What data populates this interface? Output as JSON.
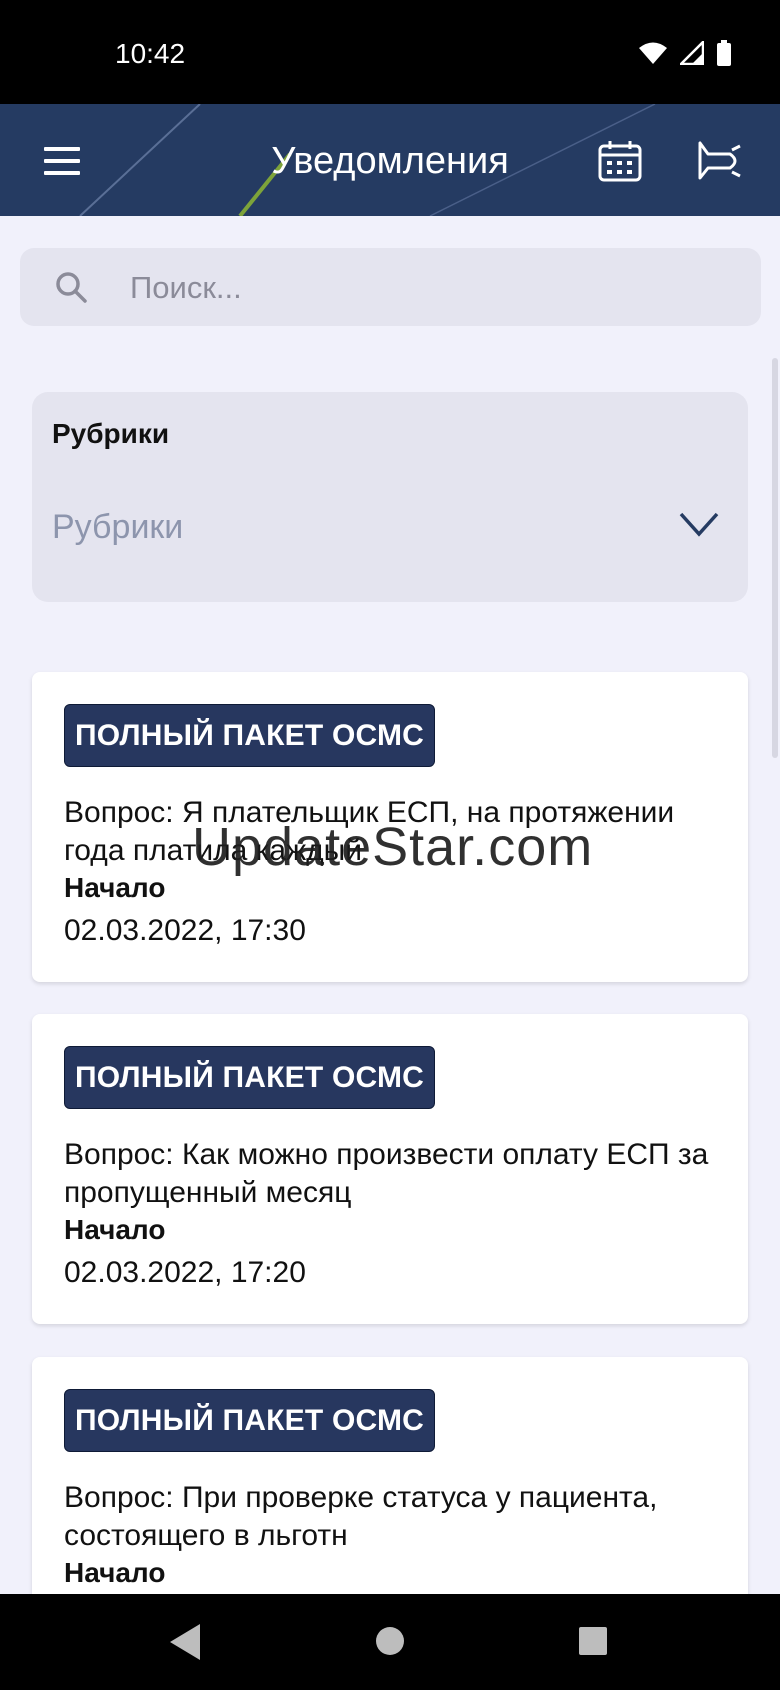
{
  "status_bar": {
    "time": "10:42"
  },
  "app_bar": {
    "title": "Уведомления"
  },
  "search": {
    "placeholder": "Поиск..."
  },
  "rubric": {
    "label": "Рубрики",
    "value": "Рубрики"
  },
  "notifications": [
    {
      "badge": "ПОЛНЫЙ ПАКЕТ ОСМС",
      "question": "Вопрос: Я плательщик ЕСП, на протяжении года платила каждый",
      "start_label": "Начало",
      "datetime": "02.03.2022, 17:30"
    },
    {
      "badge": "ПОЛНЫЙ ПАКЕТ ОСМС",
      "question": "Вопрос: Как можно произвести оплату ЕСП за пропущенный месяц",
      "start_label": "Начало",
      "datetime": "02.03.2022, 17:20"
    },
    {
      "badge": "ПОЛНЫЙ ПАКЕТ ОСМС",
      "question": "Вопрос: При проверке статуса у пациента, состоящего в льготн",
      "start_label": "Начало",
      "datetime": ""
    }
  ],
  "watermark": "UpdateStar.com",
  "colors": {
    "app_bar": "#253b62",
    "badge": "#27375f",
    "background": "#f1f1fb"
  }
}
